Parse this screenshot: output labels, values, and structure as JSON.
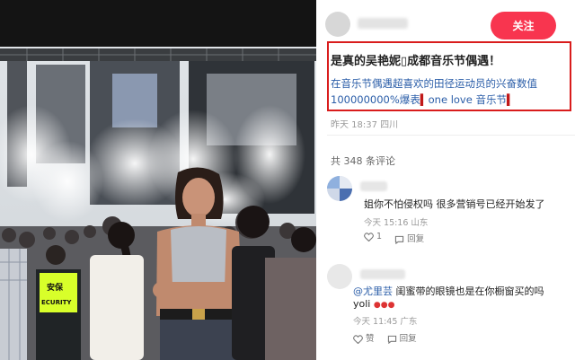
{
  "post": {
    "follow_label": "关注",
    "title": "是真的吴艳妮▯成都音乐节偶遇！",
    "body_line1": "在音乐节偶遇超喜欢的田径运动员的兴奋数值",
    "body_line2a": "100000000%爆表",
    "body_marker": "▍",
    "body_line2b": "one love 音乐节",
    "meta": "昨天 18:37 四川"
  },
  "photo": {
    "security_vest_text": "安保",
    "security_vest_text2": "ECURITY"
  },
  "comments": {
    "count_label": "共 348 条评论",
    "items": [
      {
        "text": "姐你不怕侵权吗 很多营销号已经开始发了",
        "time": "今天 15:16 山东",
        "likes": "1",
        "reply_label": "回复"
      },
      {
        "mention": "@尤里芸",
        "text": " 闺蜜带的眼镜也是在你橱窗买的吗",
        "text2": "yoli",
        "time": "今天 11:45 广东",
        "like_label": "赞",
        "reply_label": "回复"
      }
    ]
  },
  "colors": {
    "accent": "#f8354f",
    "highlight_border": "#d91c1c",
    "link_blue": "#2a5da8"
  }
}
